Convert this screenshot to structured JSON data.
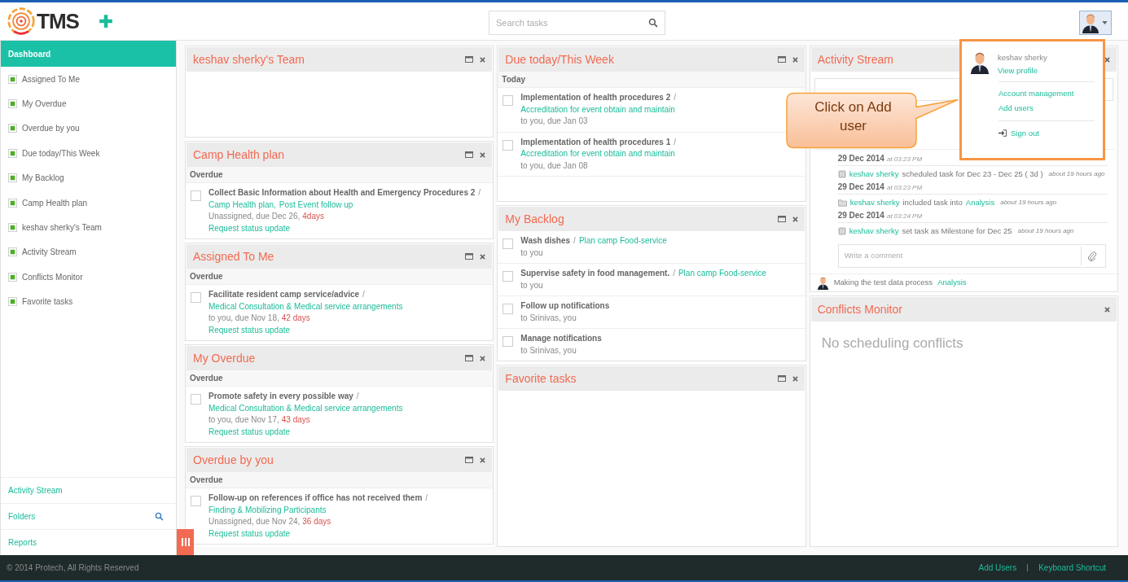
{
  "header": {
    "logo_text": "TMS",
    "search": {
      "placeholder": "Search tasks"
    }
  },
  "sidebar": {
    "items": [
      {
        "label": "Dashboard",
        "selected": true
      },
      {
        "label": "Assigned To Me",
        "selected": false
      },
      {
        "label": "My Overdue",
        "selected": false
      },
      {
        "label": "Overdue by you",
        "selected": false
      },
      {
        "label": "Due today/This Week",
        "selected": false
      },
      {
        "label": "My Backlog",
        "selected": false
      },
      {
        "label": "Camp Health plan",
        "selected": false
      },
      {
        "label": "keshav sherky's Team",
        "selected": false
      },
      {
        "label": "Activity Stream",
        "selected": false
      },
      {
        "label": "Conflicts Monitor",
        "selected": false
      },
      {
        "label": "Favorite tasks",
        "selected": false
      }
    ],
    "bottom_links": [
      {
        "label": "Activity Stream",
        "kind": "link"
      },
      {
        "label": "Folders",
        "kind": "search"
      },
      {
        "label": "Reports",
        "kind": "link"
      }
    ]
  },
  "columns": [
    [
      {
        "title": "keshav sherky's Team",
        "minimizable": true
      },
      {
        "title": "Camp Health plan",
        "minimizable": true,
        "groups": [
          {
            "label": "Overdue",
            "tasks": [
              {
                "title": "Collect Basic Information about Health and Emergency Procedures 2",
                "checked": false,
                "separator": "/",
                "projects": [
                  "Camp Health plan,",
                  "Post Event follow up"
                ],
                "meta": "Unassigned, due Dec 26,",
                "late": "4days",
                "action": "Request status update"
              }
            ]
          }
        ]
      },
      {
        "title": "Assigned To Me",
        "minimizable": true,
        "groups": [
          {
            "label": "Overdue",
            "tasks": [
              {
                "title": "Facilitate resident camp service/advice",
                "checked": false,
                "separator": "/",
                "projects": [
                  "Medical Consultation & Medical service arrangements"
                ],
                "meta": "to you, due Nov 18,",
                "late": "42 days",
                "action": "Request status update"
              }
            ]
          }
        ]
      },
      {
        "title": "My Overdue",
        "minimizable": true,
        "groups": [
          {
            "label": "Overdue",
            "tasks": [
              {
                "title": "Promote safety in every possible way",
                "checked": false,
                "separator": "/",
                "projects": [
                  "Medical Consultation & Medical service arrangements"
                ],
                "meta": "to you, due Nov 17,",
                "late": "43 days",
                "action": "Request status update"
              }
            ]
          }
        ]
      },
      {
        "title": "Overdue by you",
        "minimizable": true,
        "groups": [
          {
            "label": "Overdue",
            "tasks": [
              {
                "title": "Follow-up on references if office has not received them",
                "checked": false,
                "separator": "/",
                "projects": [
                  "Finding & Mobilizing Participants"
                ],
                "meta": "Unassigned, due Nov 24,",
                "late": "36 days",
                "action": "Request status update"
              }
            ]
          }
        ]
      }
    ],
    [
      {
        "title": "Due today/This Week",
        "minimizable": true,
        "groups": [
          {
            "label": "Today",
            "tasks": [
              {
                "title": "Implementation of health procedures 2",
                "checked": false,
                "separator": "/",
                "projects": [
                  "Accreditation for event obtain and maintain"
                ],
                "meta": "to you, due Jan 03"
              },
              {
                "title": "Implementation of health procedures 1",
                "checked": false,
                "separator": "/",
                "projects": [
                  "Accreditation for event obtain and maintain"
                ],
                "meta": "to you, due Jan 08"
              }
            ]
          }
        ]
      },
      {
        "title": "My Backlog",
        "minimizable": true,
        "groups": [
          {
            "tasks": [
              {
                "title": "Wash dishes",
                "checked": false,
                "separator": "/",
                "projects": [
                  "Plan camp Food-service"
                ],
                "meta": "to you"
              },
              {
                "title": "Supervise safety in food management.",
                "checked": false,
                "separator": "/",
                "projects": [
                  "Plan camp Food-service"
                ],
                "meta": "to you"
              },
              {
                "title": "Follow up notifications",
                "checked": false,
                "meta": "to Srinivas, you"
              },
              {
                "title": "Manage notifications",
                "checked": false,
                "meta": "to Srinivas, you"
              }
            ]
          }
        ]
      },
      {
        "title": "Favorite tasks",
        "minimizable": true
      }
    ],
    [
      {
        "title": "Activity Stream",
        "kind": "activity",
        "minimizable": false,
        "entries": [
          {
            "date": "29 Dec 2014",
            "time": "at 03:23 PM",
            "kind": "schedule",
            "actor": "keshav sherky",
            "action": "scheduled task for Dec 23 - Dec 25 ( 3d )",
            "ago": "about 19 hours ago"
          },
          {
            "date": "29 Dec 2014",
            "time": "at 03:23 PM",
            "kind": "include",
            "actor": "keshav sherky",
            "action": "included task into",
            "target": "Analysis",
            "ago": "about 19 hours ago"
          },
          {
            "date": "29 Dec 2014",
            "time": "at 03:24 PM",
            "kind": "schedule",
            "actor": "keshav sherky",
            "action": "set task as Milestone for Dec 25",
            "ago": "about 19 hours ago"
          }
        ],
        "comment_placeholder": "Write a comment",
        "footer_item": {
          "text": "Making the test data process",
          "link": "Analysis"
        }
      },
      {
        "title": "Conflicts Monitor",
        "minimizable": false,
        "empty_text": "No scheduling conflicts"
      }
    ]
  ],
  "user_menu": {
    "name": "keshav sherky",
    "profile_link": "View profile",
    "links": [
      "Account management",
      "Add users"
    ],
    "sign_out": "Sign out"
  },
  "callout": {
    "text": "Click on Add user"
  },
  "footer": {
    "copyright": "© 2014 Protech, All Rights Reserved",
    "links": [
      "Add Users",
      "Keyboard Shortcut"
    ]
  }
}
